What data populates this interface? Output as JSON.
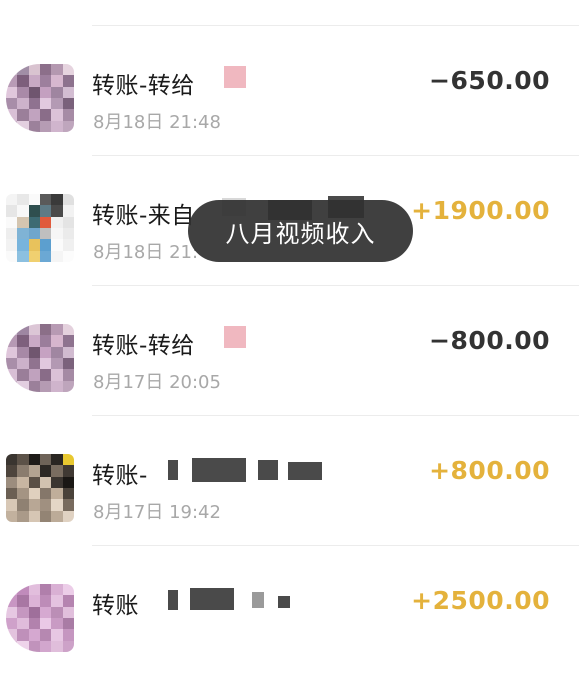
{
  "transactions": [
    {
      "title": "转账-转给",
      "time": "8月18日 21:48",
      "amount": "−650.00",
      "type": "outgoing"
    },
    {
      "title": "转账-来自",
      "time": "8月18日 21:",
      "amount": "+1900.00",
      "type": "incoming"
    },
    {
      "title": "转账-转给",
      "time": "8月17日 20:05",
      "amount": "−800.00",
      "type": "outgoing"
    },
    {
      "title": "转账-",
      "time": "8月17日 19:42",
      "amount": "+800.00",
      "type": "incoming"
    },
    {
      "title": "转账",
      "time": "",
      "amount": "+2500.00",
      "type": "incoming"
    }
  ],
  "toast": {
    "text": "八月视频收入"
  },
  "colors": {
    "incoming": "#e4b23c",
    "outgoing": "#333333",
    "time": "#a8a8a8"
  }
}
